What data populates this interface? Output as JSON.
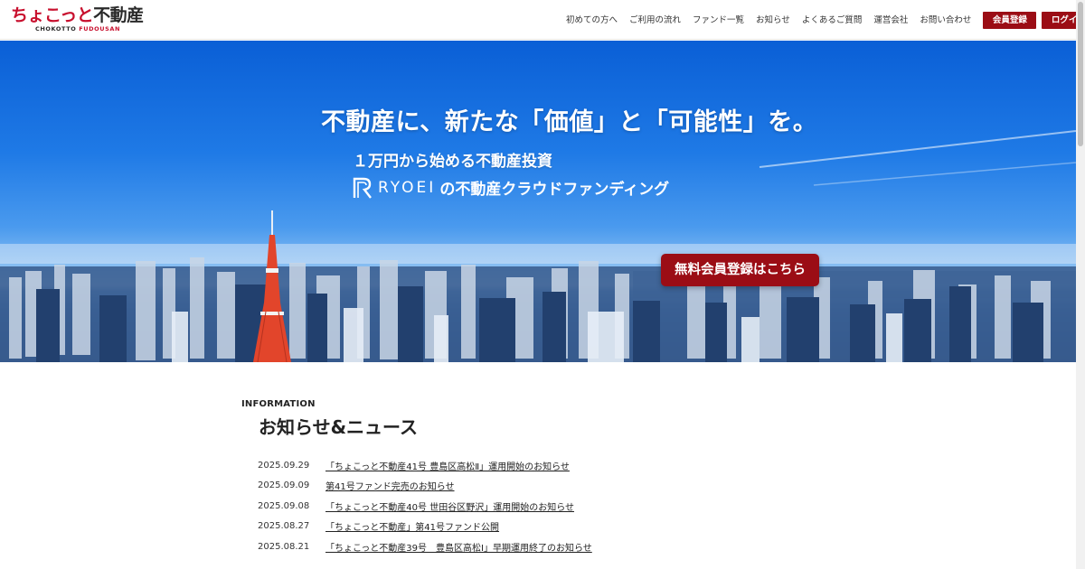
{
  "header": {
    "logo_main_red": "ちょこっと",
    "logo_main_dark": "不動産",
    "logo_sub_dark": "CHOKOTTO ",
    "logo_sub_red": "FUDOUSAN",
    "nav": [
      {
        "label": "初めての方へ"
      },
      {
        "label": "ご利用の流れ"
      },
      {
        "label": "ファンド一覧"
      },
      {
        "label": "お知らせ"
      },
      {
        "label": "よくあるご質問"
      },
      {
        "label": "運営会社"
      },
      {
        "label": "お問い合わせ"
      }
    ],
    "register_label": "会員登録",
    "login_label": "ログイン"
  },
  "hero": {
    "title": "不動産に、新たな「価値」と「可能性」を。",
    "subtitle": "１万円から始める不動産投資",
    "brand_name": "RYOEI",
    "brand_rest": "の不動産クラウドファンディング",
    "cta_label": "無料会員登録はこちら"
  },
  "news": {
    "eyebrow": "INFORMATION",
    "title": "お知らせ&ニュース",
    "items": [
      {
        "date": "2025.09.29",
        "text": "「ちょこっと不動産41号 豊島区高松Ⅱ」運用開始のお知らせ"
      },
      {
        "date": "2025.09.09",
        "text": "第41号ファンド完売のお知らせ"
      },
      {
        "date": "2025.09.08",
        "text": "「ちょこっと不動産40号 世田谷区野沢」運用開始のお知らせ"
      },
      {
        "date": "2025.08.27",
        "text": "「ちょこっと不動産」第41号ファンド公開"
      },
      {
        "date": "2025.08.21",
        "text": "「ちょこっと不動産39号　豊島区高松Ⅰ」早期運用終了のお知らせ"
      }
    ]
  },
  "colors": {
    "brand_red": "#c8102e",
    "button_red": "#9b0d15",
    "sky_blue": "#1f7ae6"
  }
}
